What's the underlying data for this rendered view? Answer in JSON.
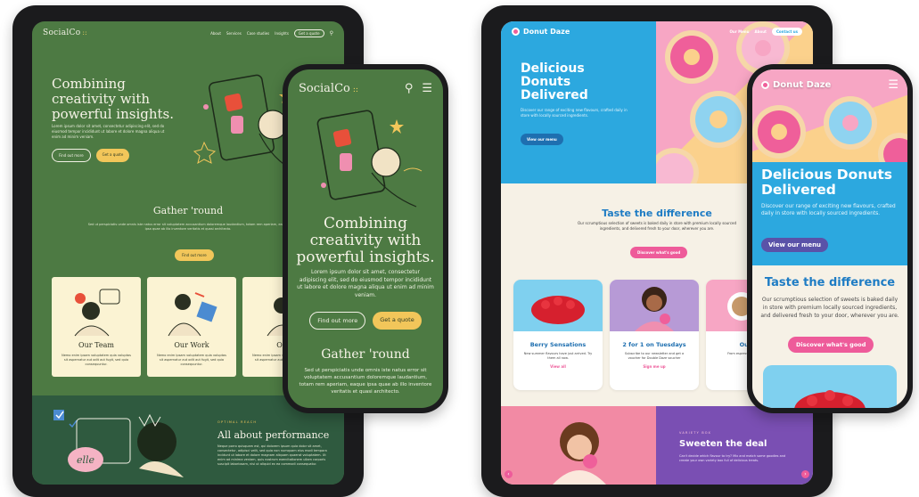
{
  "socialco": {
    "logo": "SocialCo",
    "logo_mark": "::",
    "nav": [
      "About",
      "Services",
      "Case studies",
      "Insights"
    ],
    "nav_cta": "Get a quote",
    "hero_title": "Combining creativity with powerful insights.",
    "hero_lead": "Lorem ipsum dolor sit amet, consectetur adipiscing elit, sed do eiusmod tempor incididunt ut labore et dolore magna aliqua ut enim ad minim veniam.",
    "btn_find": "Find out more",
    "btn_quote": "Get a quote",
    "gather_title": "Gather 'round",
    "gather_text": "Sed ut perspiciatis unde omnis iste natus error sit voluptatem accusantium doloremque laudantium, totam rem aperiam, eaque ipsa quae ab illo inventore veritatis et quasi architecto.",
    "gather_btn": "Find out more",
    "cards": [
      {
        "title": "Our Team",
        "text": "Nemo enim ipsam voluptatem quia voluptas sit aspernatur aut odit aut fugit, sed quia consequuntur."
      },
      {
        "title": "Our Work",
        "text": "Nemo enim ipsam voluptatem quia voluptas sit aspernatur aut odit aut fugit, sed quia consequuntur."
      },
      {
        "title": "Our S",
        "text": "Nemo enim ipsam voluptatem quia voluptas sit aspernatur aut odit aut fugit, sed quia"
      }
    ],
    "perf_eyebrow": "OPTIMAL REACH",
    "perf_title": "All about performance",
    "perf_text": "Neque porro quisquam est, qui dolorem ipsum quia dolor sit amet, consectetur, adipisci velit, sed quia non numquam eius modi tempora incidunt ut labore et dolore magnam aliquam quaerat voluptatem. Ut enim ad minima veniam, quis nostrum exercitationem ullam corporis suscipit laboriosam, nisi ut aliquid ex ea commodi consequatur.",
    "phone_hero_title": "Combining creativity with powerful insights.",
    "phone_lead": "Lorem ipsum dolor sit amet, consectetur adipiscing elit, sed do eiusmod tempor incididunt ut labore et dolore magna aliqua ut enim ad minim veniam.",
    "phone_gather_title": "Gather 'round",
    "phone_gather_text": "Sed ut perspiciatis unde omnis iste natus error sit voluptatem accusantium doloremque laudantium, totam rem aperiam, eaque ipsa quae ab illo inventore veritatis et quasi architecto."
  },
  "donut": {
    "logo": "Donut Daze",
    "nav": [
      "Our Menu",
      "About"
    ],
    "nav_cta": "Contact us",
    "hero_title": "Delicious Donuts Delivered",
    "hero_lead": "Discover our range of exciting new flavours, crafted daily in store with locally sourced ingredients.",
    "hero_btn": "View our menu",
    "taste_title": "Taste the difference",
    "taste_text": "Our scrumptious selection of sweets is baked daily in store with premium locally sourced ingredients, and delivered fresh to your door, wherever you are.",
    "taste_btn": "Discover what's good",
    "cards": [
      {
        "title": "Berry Sensations",
        "text": "New summer flavours have just arrived. Try them all now.",
        "link": "View all"
      },
      {
        "title": "2 for 1 on Tuesdays",
        "text": "Subscribe to our newsletter and get a voucher for Double Daze voucher",
        "link": "Sign me up"
      },
      {
        "title": "Our Co",
        "text": "From espresso get lots of opti",
        "link": "Vi"
      }
    ],
    "deal_eyebrow": "VARIETY BOX",
    "deal_title": "Sweeten the deal",
    "deal_text": "Can't decide which flavour to try? Mix and match some goodies and create your own variety box full of delicious treats.",
    "phone_hero_title": "Delicious Donuts Delivered",
    "phone_lead": "Discover our range of exciting new flavours, crafted daily in store with locally sourced ingredients.",
    "phone_btn": "View our menu",
    "phone_taste_title": "Taste the difference",
    "phone_taste_text": "Our scrumptious selection of sweets is baked daily in store with premium locally sourced ingredients, and delivered fresh to your door, wherever you are.",
    "phone_taste_btn": "Discover what's good"
  },
  "colors": {
    "socialco_green": "#4d7a43",
    "socialco_yellow": "#f2c65a",
    "donut_blue": "#2ca8df",
    "donut_pink": "#ee5b9a",
    "donut_purple": "#7a4fb3"
  },
  "icons": {
    "search": "search-icon",
    "menu": "hamburger-icon",
    "arrow_left": "arrow-left-icon",
    "arrow_right": "arrow-right-icon"
  }
}
